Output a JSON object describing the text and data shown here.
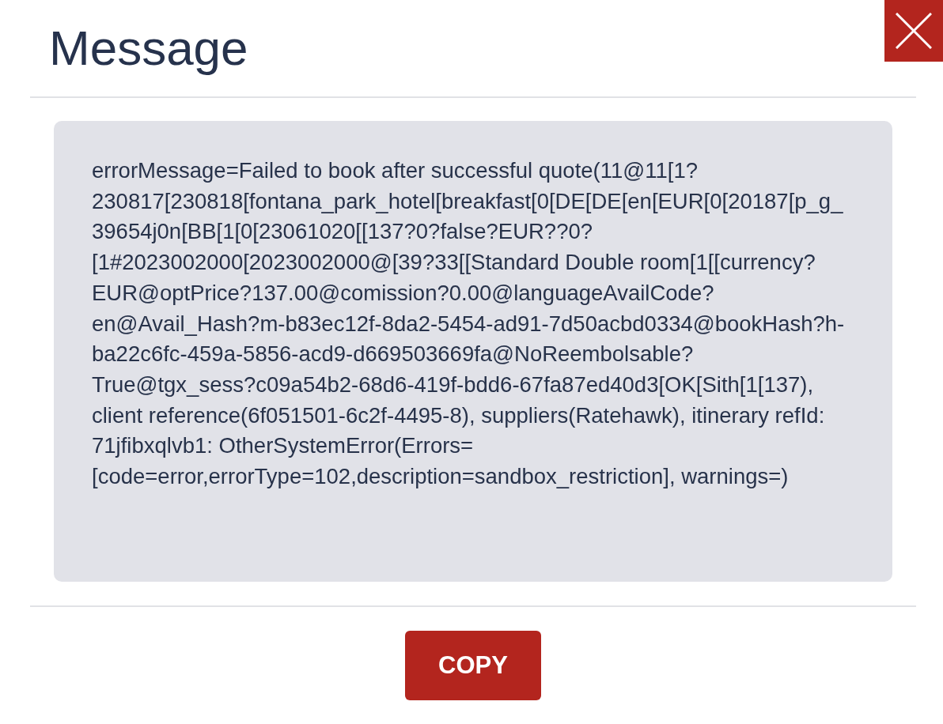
{
  "dialog": {
    "title": "Message",
    "message": "errorMessage=Failed to book after successful quote(11@11[1?230817[230818[fontana_park_hotel[breakfast[0[DE[DE[en[EUR[0[20187[p_g_39654j0n[BB[1[0[23061020[[137?0?false?EUR??0?[1#2023002000[2023002000@[39?33[[Standard Double room[1[[currency?EUR@optPrice?137.00@comission?0.00@languageAvailCode?en@Avail_Hash?m-b83ec12f-8da2-5454-ad91-7d50acbd0334@bookHash?h-ba22c6fc-459a-5856-acd9-d669503669fa@NoReembolsable?True@tgx_sess?c09a54b2-68d6-419f-bdd6-67fa87ed40d3[OK[Sith[1[137), client reference(6f051501-6c2f-4495-8), suppliers(Ratehawk), itinerary refId: 71jfibxqlvb1: OtherSystemError(Errors=[code=error,errorType=102,description=sandbox_restriction], warnings=)",
    "buttons": [
      {
        "label": "COPY"
      }
    ]
  }
}
